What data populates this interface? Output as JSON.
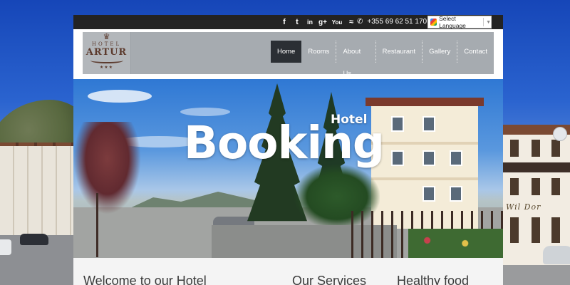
{
  "topbar": {
    "social_icons": [
      "facebook-icon",
      "twitter-icon",
      "linkedin-icon",
      "google-plus-icon",
      "youtube-icon",
      "rss-icon"
    ],
    "social_glyphs": [
      "f",
      "t",
      "in",
      "g+",
      "You",
      "≈"
    ],
    "phone": "+355 69 62 51 170",
    "language_label": "Select Language"
  },
  "logo": {
    "small": "HOTEL",
    "name": "ARTUR",
    "stars": "★★★"
  },
  "nav": {
    "items": [
      "Home",
      "Rooms",
      "About Us",
      "Restaurant",
      "Gallery",
      "Contact"
    ],
    "active": "Home"
  },
  "hero": {
    "title": "Booking",
    "subtitle": "Hotel"
  },
  "background": {
    "right_sign": "Wil Dor"
  },
  "sections": {
    "welcome": "Welcome to our Hotel",
    "services": "Our Services",
    "food": "Healthy food"
  },
  "colors": {
    "topbar": "#232323",
    "header": "#a6abb0",
    "nav_active": "#2b2f34"
  }
}
